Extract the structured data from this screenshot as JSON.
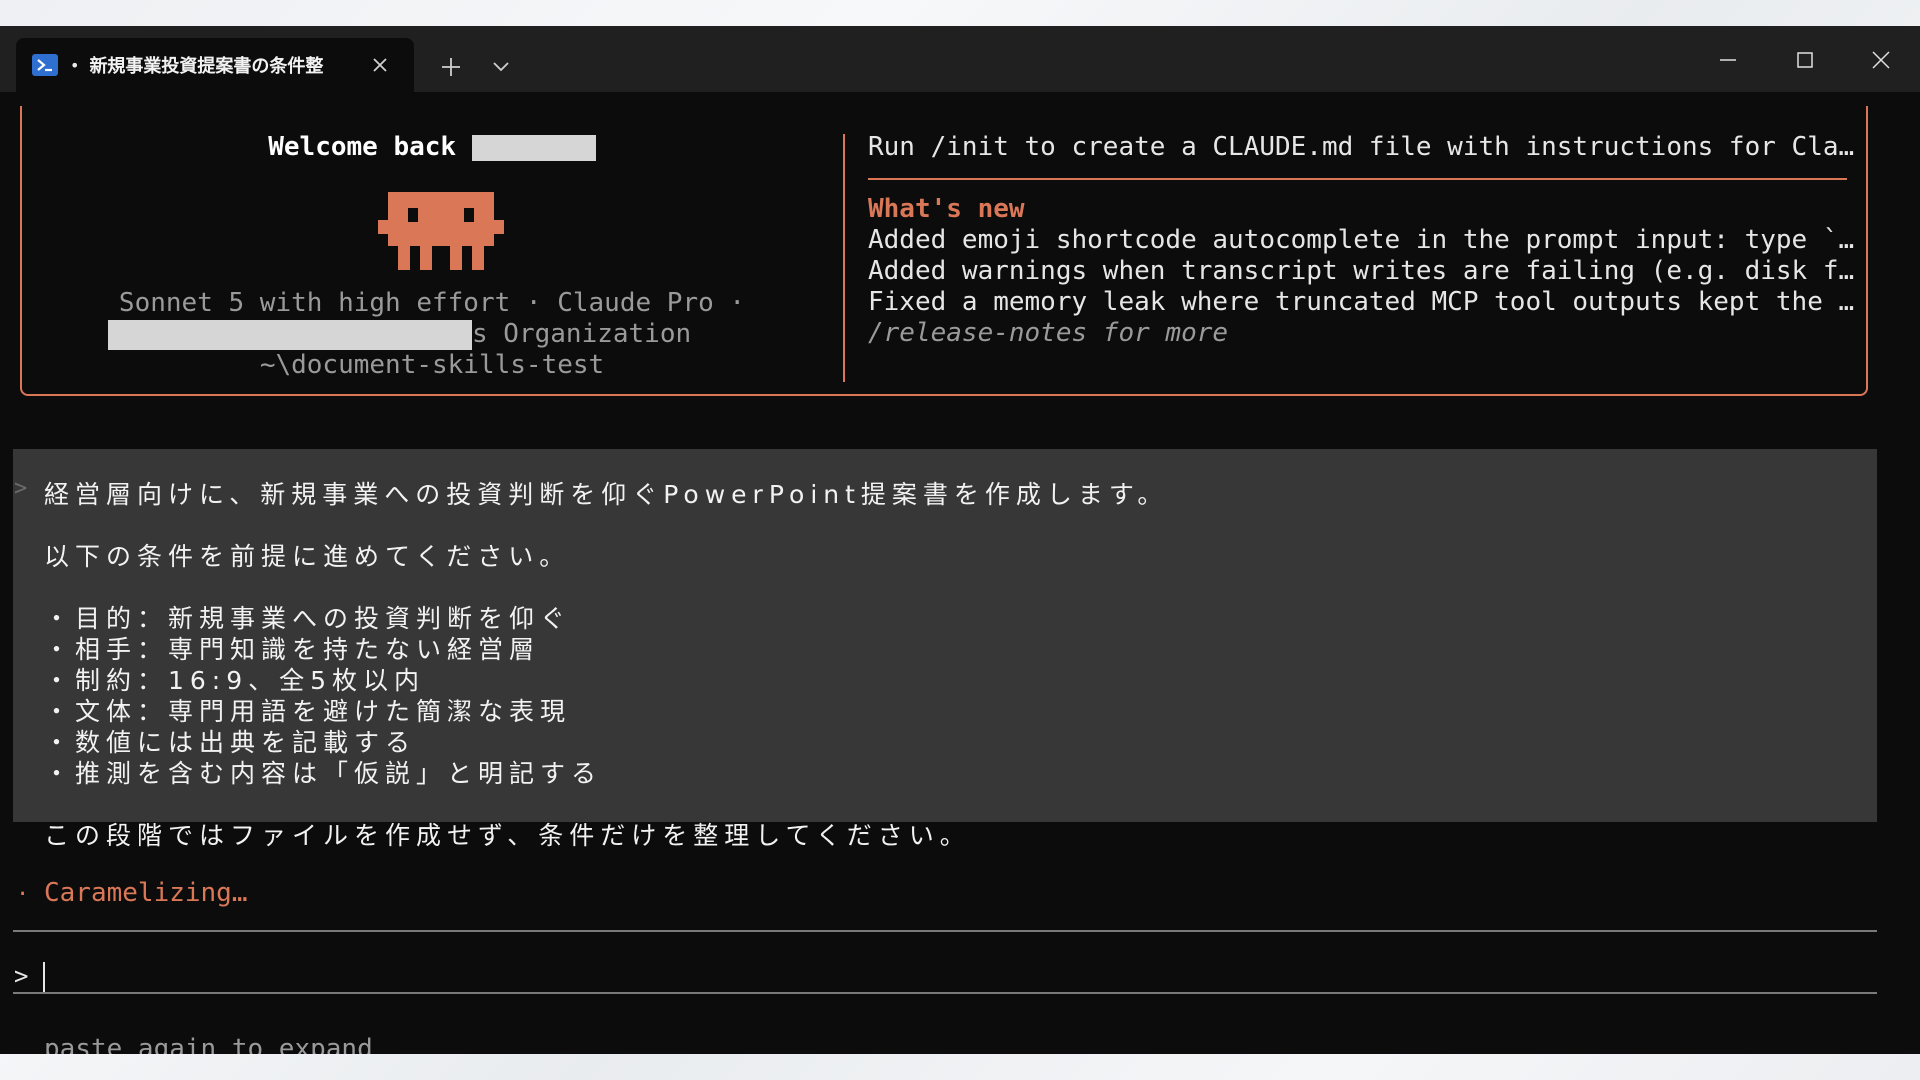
{
  "tab": {
    "title": "新規事業投資提案書の条件整",
    "dot": "•",
    "icon": "powershell-icon"
  },
  "welcome": {
    "greeting": "Welcome back",
    "model_line": "Sonnet 5 with high effort · Claude Pro ·",
    "org_suffix": "s Organization",
    "path": "~\\document-skills-test"
  },
  "tips": {
    "init_line": "Run /init to create a CLAUDE.md file with instructions for Cla…"
  },
  "whats_new": {
    "title": "What's new",
    "items": [
      "Added emoji shortcode autocomplete in the prompt input: type `…",
      "Added warnings when transcript writes are failing (e.g. disk f…",
      "Fixed a memory leak where truncated MCP tool outputs kept the …"
    ],
    "more": "/release-notes for more"
  },
  "prompt": {
    "caret": ">",
    "lines": [
      "経営層向けに、新規事業への投資判断を仰ぐPowerPoint提案書を作成します。",
      "以下の条件を前提に進めてください。",
      "・目的：新規事業への投資判断を仰ぐ",
      "・相手：専門知識を持たない経営層",
      "・制約：16:9、全5枚以内",
      "・文体：専門用語を避けた簡潔な表現",
      "・数値には出典を記載する",
      "・推測を含む内容は「仮説」と明記する",
      "この段階ではファイルを作成せず、条件だけを整理してください。"
    ]
  },
  "status": {
    "dot": "·",
    "text": "Caramelizing…"
  },
  "input": {
    "caret": ">",
    "hint": "paste again to expand"
  },
  "colors": {
    "accent": "#d97757",
    "terminal_bg": "#0c0c0c",
    "prompt_bg": "#373737",
    "titlebar_bg": "#202020"
  }
}
